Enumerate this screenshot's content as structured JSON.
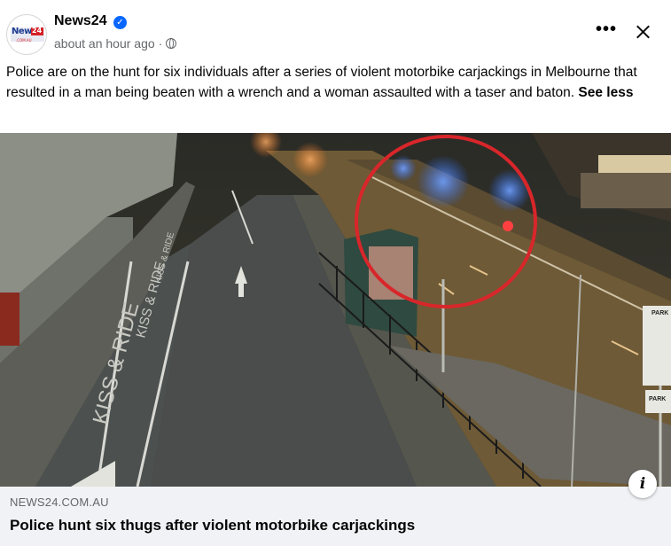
{
  "post": {
    "page_name": "News24",
    "verified_icon": "verified-badge-icon",
    "timestamp": "about an hour ago",
    "separator": "·",
    "audience_icon": "globe-icon",
    "more_label": "•••",
    "close_icon": "close-icon",
    "logo": {
      "text_main": "News",
      "text_red": "24",
      "text_sub": ".COM.AU"
    },
    "caption_text": "Police are on the hunt for six individuals after a series of violent motorbike carjackings in Melbourne that resulted in a man being beaten with a wrench and a woman assaulted with a taser and baton.",
    "see_less_label": "See less"
  },
  "media": {
    "scene_signs": {
      "kiss_ride_1": "KISS & RIDE",
      "kiss_ride_2": "KISS & RIDE",
      "kiss_ride_3": "KISS & RIDE",
      "park_1": "PARK",
      "park_2": "PARK"
    },
    "colors": {
      "circle": "#d8262a",
      "road": "#6e5a36",
      "police_light": "#2a6bff"
    }
  },
  "link": {
    "domain": "NEWS24.COM.AU",
    "headline": "Police hunt six thugs after violent motorbike carjackings",
    "info_label": "i"
  }
}
